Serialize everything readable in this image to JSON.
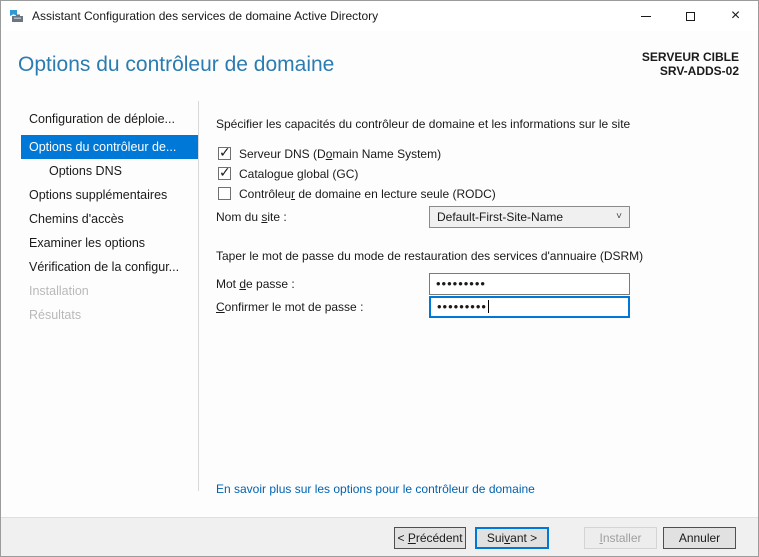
{
  "window": {
    "title": "Assistant Configuration des services de domaine Active Directory"
  },
  "header": {
    "title": "Options du contrôleur de domaine",
    "target_server_label": "SERVEUR CIBLE",
    "target_server_name": "SRV-ADDS-02"
  },
  "sidebar": {
    "items": [
      {
        "label": "Configuration de déploie...",
        "state": "normal"
      },
      {
        "label": "Options du contrôleur de...",
        "state": "selected"
      },
      {
        "label": "Options DNS",
        "state": "normal",
        "indent": true
      },
      {
        "label": "Options supplémentaires",
        "state": "normal"
      },
      {
        "label": "Chemins d'accès",
        "state": "normal"
      },
      {
        "label": "Examiner les options",
        "state": "normal"
      },
      {
        "label": "Vérification de la configur...",
        "state": "normal"
      },
      {
        "label": "Installation",
        "state": "disabled"
      },
      {
        "label": "Résultats",
        "state": "disabled"
      }
    ]
  },
  "content": {
    "intro": "Spécifier les capacités du contrôleur de domaine et les informations sur le site",
    "checkboxes": [
      {
        "pre": "Serveur DNS (D",
        "accel": "o",
        "post": "main Name System)",
        "checked": true
      },
      {
        "pre": "Catalogue ",
        "accel": "g",
        "post": "lobal (GC)",
        "checked": true
      },
      {
        "pre": "Contrôleu",
        "accel": "r",
        "post": " de domaine en lecture seule (RODC)",
        "checked": false
      }
    ],
    "site": {
      "label_pre": "Nom du ",
      "label_accel": "s",
      "label_post": "ite :",
      "value": "Default-First-Site-Name",
      "chevron": "˅"
    },
    "dsrm_heading": "Taper le mot de passe du mode de restauration des services d'annuaire (DSRM)",
    "password": {
      "label_pre": "Mot ",
      "label_accel": "d",
      "label_post": "e passe :",
      "value_masked": "•••••••••"
    },
    "confirm": {
      "label_pre": "",
      "label_accel": "C",
      "label_post": "onfirmer le mot de passe :",
      "value_masked": "•••••••••"
    },
    "link": "En savoir plus sur les options pour le contrôleur de domaine"
  },
  "footer": {
    "buttons": {
      "previous": {
        "pre": "< ",
        "accel": "P",
        "post": "récédent"
      },
      "next": {
        "pre": "Sui",
        "accel": "v",
        "post": "ant >"
      },
      "install": {
        "pre": "",
        "accel": "I",
        "post": "nstaller"
      },
      "cancel": {
        "pre": "Annuler",
        "accel": "",
        "post": ""
      }
    }
  },
  "colors": {
    "accent": "#0078d7",
    "header_blue": "#2b7cb0",
    "link_blue": "#0063b1",
    "footer_bg": "#f0f0f0",
    "button_bg": "#e1e1e1",
    "text": "#1a1a1a",
    "disabled_text": "#a6a6a6"
  }
}
